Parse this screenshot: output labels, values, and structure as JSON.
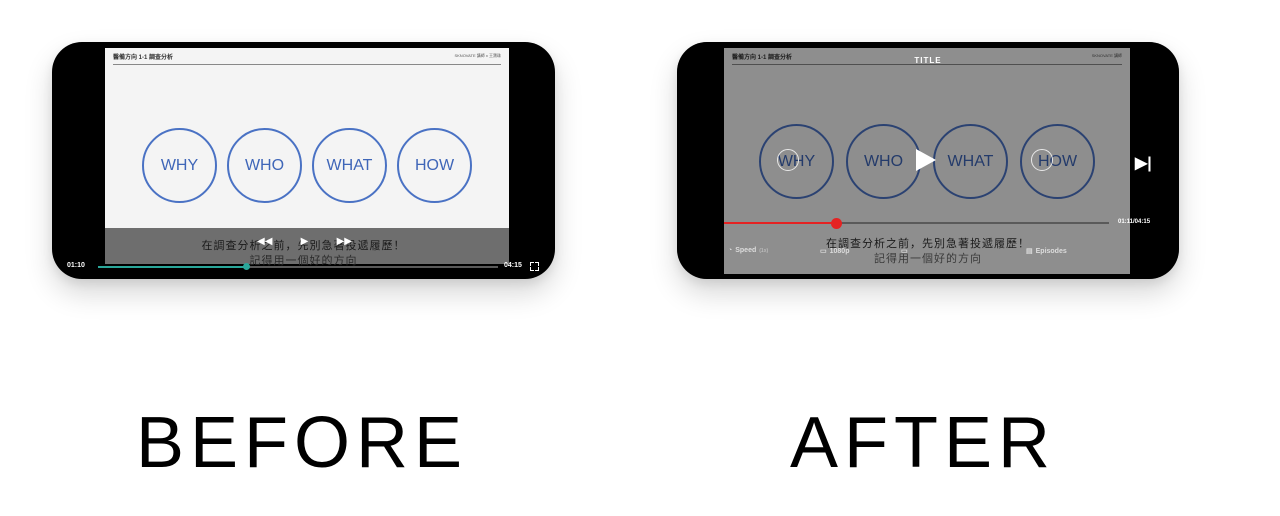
{
  "before": {
    "slide_title": "醫備方向 1-1 調查分析",
    "slide_brand": "SKNOVATE 講師 x 王寶珠",
    "circles": [
      "WHY",
      "WHO",
      "WHAT",
      "HOW"
    ],
    "subtitle_line1": "在調查分析之前，先別急著投遞履歷！",
    "subtitle_line2": "記得用一個好的方向",
    "controls": {
      "rewind": "◀◀",
      "play": "▶",
      "forward": "▶▶"
    },
    "time_current": "01:10",
    "time_total": "04:15",
    "progress_fraction": 0.37,
    "accent_color": "#2aa79a"
  },
  "after": {
    "slide_title": "醫備方向 1-1 調查分析",
    "slide_brand": "SKNOVATE 講師",
    "title_overlay": "TITLE",
    "circles": [
      "WHY",
      "WHO",
      "WHAT",
      "HOW"
    ],
    "subtitle_line1": "在調查分析之前，先別急著投遞履歷！",
    "subtitle_line2": "記得用一個好的方向",
    "time_display": "01:11/04:15",
    "progress_fraction": 0.29,
    "accent_color": "#e52222",
    "bottom_controls": {
      "speed_label": "Speed",
      "speed_value": "(1x)",
      "quality_label": "1080p",
      "episodes_label": "Episodes"
    }
  },
  "captions": {
    "before": "BEFORE",
    "after": "AFTER"
  }
}
